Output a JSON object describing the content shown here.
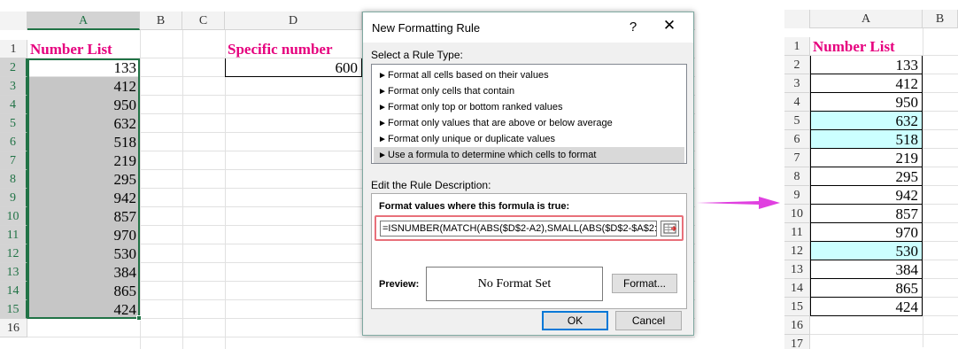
{
  "left_sheet": {
    "columns": [
      "A",
      "B",
      "C",
      "D"
    ],
    "rows": [
      "1",
      "2",
      "3",
      "4",
      "5",
      "6",
      "7",
      "8",
      "9",
      "10",
      "11",
      "12",
      "13",
      "14",
      "15",
      "16"
    ],
    "list_header": "Number List",
    "numbers": [
      "133",
      "412",
      "950",
      "632",
      "518",
      "219",
      "295",
      "942",
      "857",
      "970",
      "530",
      "384",
      "865",
      "424"
    ],
    "specific_header": "Specific number",
    "specific_value": "600"
  },
  "dialog": {
    "title": "New Formatting Rule",
    "help": "?",
    "close": "✕",
    "select_label": "Select a Rule Type:",
    "rule_types": [
      "Format all cells based on their values",
      "Format only cells that contain",
      "Format only top or bottom ranked values",
      "Format only values that are above or below average",
      "Format only unique or duplicate values",
      "Use a formula to determine which cells to format"
    ],
    "edit_label": "Edit the Rule Description:",
    "formula_label": "Format values where this formula is true:",
    "formula_value": "=ISNUMBER(MATCH(ABS($D$2-A2),SMALL(ABS($D$2-$A$2:$A$",
    "preview_label": "Preview:",
    "preview_text": "No Format Set",
    "format_button": "Format...",
    "ok_button": "OK",
    "cancel_button": "Cancel"
  },
  "right_sheet": {
    "columns": [
      "A",
      "B"
    ],
    "rows": [
      "1",
      "2",
      "3",
      "4",
      "5",
      "6",
      "7",
      "8",
      "9",
      "10",
      "11",
      "12",
      "13",
      "14",
      "15",
      "16",
      "17"
    ],
    "list_header": "Number List",
    "numbers": [
      "133",
      "412",
      "950",
      "632",
      "518",
      "219",
      "295",
      "942",
      "857",
      "970",
      "530",
      "384",
      "865",
      "424"
    ],
    "highlighted_rows": [
      "5",
      "6",
      "12"
    ]
  },
  "colors": {
    "header_text": "#e6007e",
    "selection_green": "#217346",
    "highlight": "#ccffff",
    "arrow": "#e040e0",
    "formula_outline": "#e8707a"
  }
}
